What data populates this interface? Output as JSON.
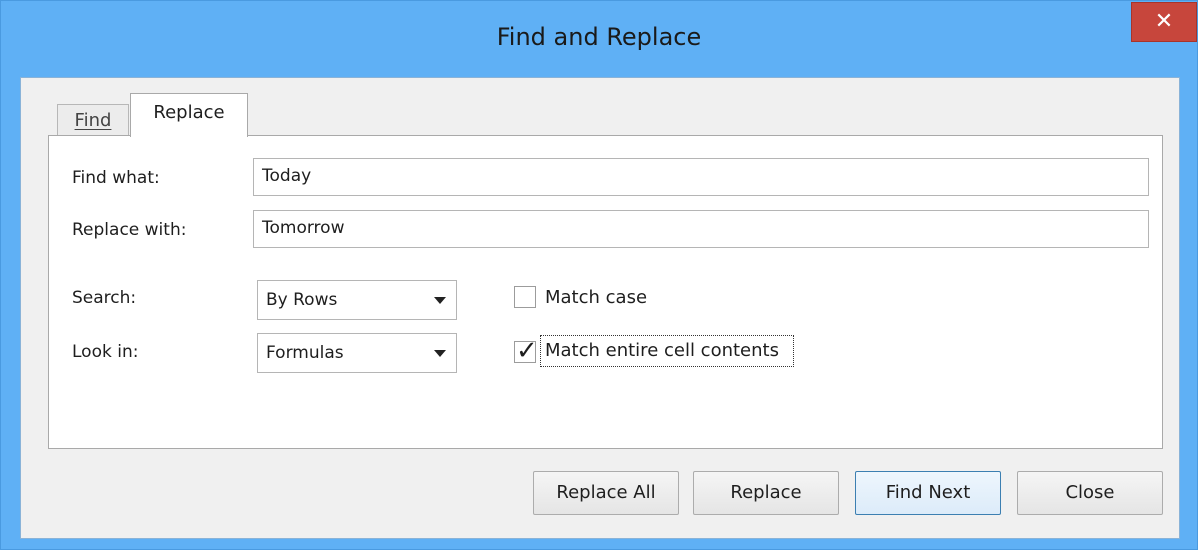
{
  "window": {
    "title": "Find and Replace",
    "close_glyph": "✕"
  },
  "tabs": [
    {
      "label": "Find",
      "active": false
    },
    {
      "label": "Replace",
      "active": true
    }
  ],
  "form": {
    "find_label": "Find what:",
    "find_value": "Today",
    "replace_label": "Replace with:",
    "replace_value": "Tomorrow",
    "search_label": "Search:",
    "search_value": "By Rows",
    "lookin_label": "Look in:",
    "lookin_value": "Formulas",
    "match_case_label": "Match case",
    "match_case_checked": false,
    "match_entire_label": "Match entire cell contents",
    "match_entire_checked": true,
    "check_glyph": "✓"
  },
  "buttons": {
    "replace_all": "Replace All",
    "replace": "Replace",
    "find_next": "Find Next",
    "close": "Close"
  },
  "colors": {
    "titlebar": "#5fb0f5",
    "close_button": "#c7463c"
  }
}
